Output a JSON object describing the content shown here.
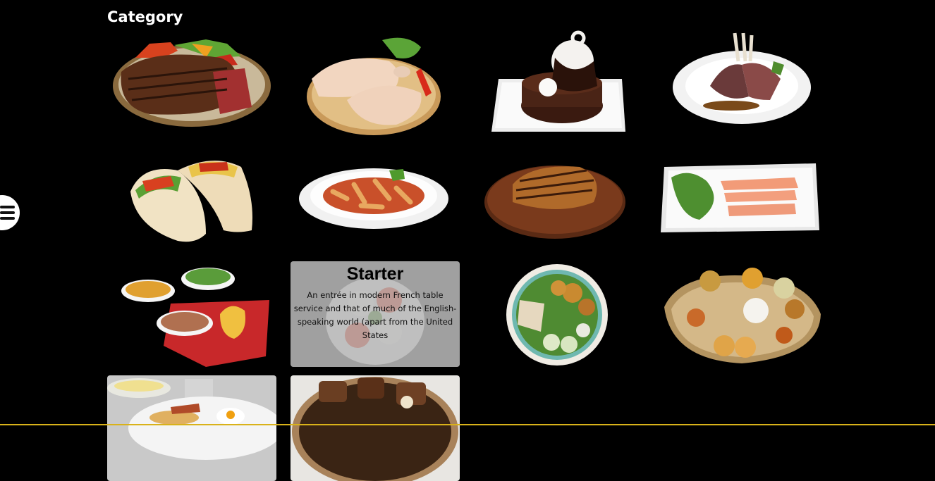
{
  "page": {
    "title": "Category"
  },
  "menu": {
    "icon": "hamburger-menu-icon"
  },
  "categories": [
    {
      "name": "steak",
      "icon": "steak-icon"
    },
    {
      "name": "chicken",
      "icon": "chicken-icon"
    },
    {
      "name": "dessert",
      "icon": "chocolate-cake-icon"
    },
    {
      "name": "lamb",
      "icon": "lamb-chops-icon"
    },
    {
      "name": "tacos",
      "icon": "tacos-icon"
    },
    {
      "name": "pasta",
      "icon": "penne-pasta-icon"
    },
    {
      "name": "grill",
      "icon": "grilled-steak-board-icon"
    },
    {
      "name": "salmon",
      "icon": "salmon-platter-icon"
    },
    {
      "name": "sides",
      "icon": "side-dishes-icon"
    },
    {
      "name": "starter",
      "icon": "caprese-salad-icon",
      "overlay_title": "Starter",
      "overlay_text": "An entrée in modern French table service and that of much of the English-speaking world (apart from the United States"
    },
    {
      "name": "bowl",
      "icon": "salad-bowl-icon"
    },
    {
      "name": "thali",
      "icon": "indian-thali-icon"
    },
    {
      "name": "breakfast",
      "icon": "breakfast-plate-icon"
    },
    {
      "name": "stew",
      "icon": "beef-stew-icon"
    }
  ],
  "colors": {
    "background": "#000000",
    "accent_line": "#d9b21a"
  }
}
